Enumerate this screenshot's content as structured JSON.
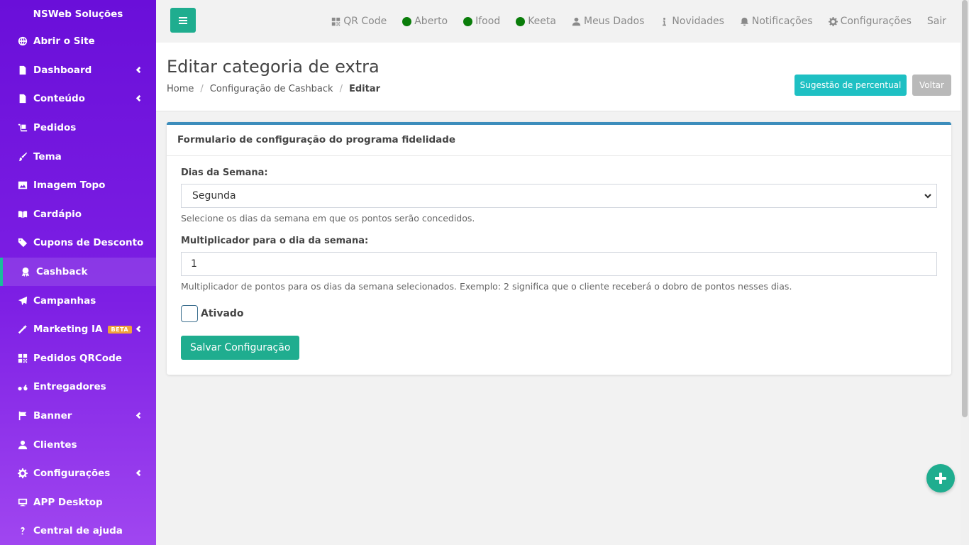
{
  "brand": "NSWeb Soluções",
  "sidebar": {
    "items": [
      {
        "label": "Abrir o Site",
        "icon": "globe-icon"
      },
      {
        "label": "Dashboard",
        "icon": "file-icon",
        "chevron": true
      },
      {
        "label": "Conteúdo",
        "icon": "file-icon",
        "chevron": true
      },
      {
        "label": "Pedidos",
        "icon": "dolly-icon"
      },
      {
        "label": "Tema",
        "icon": "brush-icon"
      },
      {
        "label": "Imagem Topo",
        "icon": "image-icon"
      },
      {
        "label": "Cardápio",
        "icon": "book-icon"
      },
      {
        "label": "Cupons de Desconto",
        "icon": "tags-icon"
      },
      {
        "label": "Cashback",
        "icon": "award-icon",
        "active": true
      },
      {
        "label": "Campanhas",
        "icon": "paper-plane-icon"
      },
      {
        "label": "Marketing IA",
        "icon": "magic-wand-icon",
        "chevron": true,
        "badge": "BETA"
      },
      {
        "label": "Pedidos QRCode",
        "icon": "qrcode-icon"
      },
      {
        "label": "Entregadores",
        "icon": "motorcycle-icon"
      },
      {
        "label": "Banner",
        "icon": "flag-icon",
        "chevron": true
      },
      {
        "label": "Clientes",
        "icon": "user-icon"
      },
      {
        "label": "Configurações",
        "icon": "gear-icon",
        "chevron": true
      },
      {
        "label": "APP Desktop",
        "icon": "desktop-icon"
      },
      {
        "label": "Central de ajuda",
        "icon": "question-icon"
      }
    ]
  },
  "topbar": {
    "links": [
      {
        "label": "QR Code",
        "icon": "qrcode-icon"
      },
      {
        "label": "Aberto",
        "status_dot": true
      },
      {
        "label": "Ifood",
        "status_dot": true
      },
      {
        "label": "Keeta",
        "status_dot": true
      },
      {
        "label": "Meus Dados",
        "icon": "user-icon"
      },
      {
        "label": "Novidades",
        "icon": "info-icon"
      },
      {
        "label": "Notificações",
        "icon": "bell-icon"
      },
      {
        "label": "Configurações",
        "icon": "gear-icon"
      },
      {
        "label": "Sair"
      }
    ]
  },
  "header": {
    "title": "Editar categoria de extra",
    "breadcrumb": [
      "Home",
      "Configuração de Cashback",
      "Editar"
    ],
    "suggest_button": "Sugestão de percentual",
    "back_button": "Voltar"
  },
  "form": {
    "card_title": "Formulario de configuração do programa fidelidade",
    "weekday_label": "Dias da Semana:",
    "weekday_value": "Segunda",
    "weekday_help": "Selecione os dias da semana em que os pontos serão concedidos.",
    "multiplier_label": "Multiplicador para o dia da semana:",
    "multiplier_value": "1",
    "multiplier_help": "Multiplicador de pontos para os dias da semana selecionados. Exemplo: 2 significa que o cliente receberá o dobro de pontos nesses dias.",
    "active_label": "Ativado",
    "active_checked": false,
    "save_button": "Salvar Configuração"
  },
  "colors": {
    "sidebar_top": "#6a0fd9",
    "sidebar_bottom": "#a046f0",
    "accent_green": "#1fad8f",
    "accent_cyan": "#1ec0c3",
    "status_green": "#0a7d0a",
    "card_top_border": "#3c8dbc"
  }
}
